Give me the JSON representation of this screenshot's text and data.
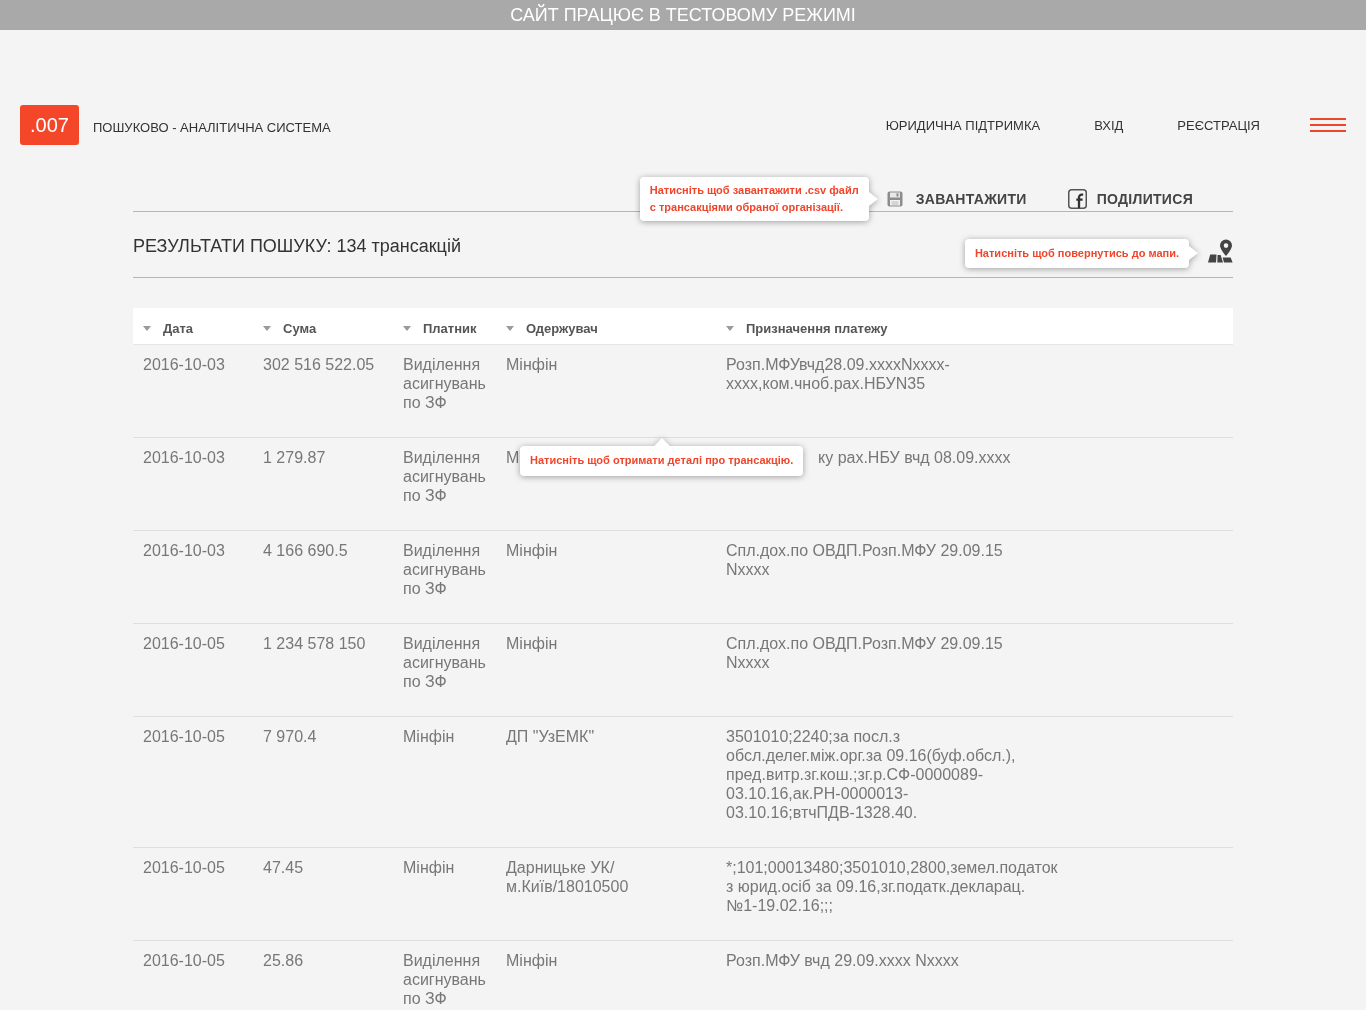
{
  "banner": {
    "text": "САЙТ ПРАЦЮЄ В ТЕСТОВОМУ РЕЖИМІ"
  },
  "header": {
    "logo": ".007",
    "subtitle": "ПОШУКОВО - АНАЛІТИЧНА СИСТЕМА",
    "nav": [
      "ЮРИДИЧНА ПІДТРИМКА",
      "ВХІД",
      "РЕЄСТРАЦІЯ"
    ]
  },
  "toolbar": {
    "tooltip": "Натисніть щоб завантажити .csv файл\nс трансакціями обраної організації.",
    "actions": [
      {
        "kind": "download",
        "label": "ЗАВАНТАЖИТИ"
      },
      {
        "kind": "share",
        "label": "ПОДІЛИТИСЯ"
      }
    ]
  },
  "results": {
    "title": "РЕЗУЛЬТАТИ ПОШУКУ: 134 трансакцій",
    "map_tooltip": "Натисніть щоб повернутись до мапи."
  },
  "table": {
    "columns": [
      "Дата",
      "Сума",
      "Платник",
      "Одержувач",
      "Призначення платежу"
    ],
    "rows": [
      {
        "date": "2016-10-03",
        "amount": "302 516 522.05",
        "payer": "Виділення\nасигнувань\nпо ЗФ",
        "recipient": "Мінфін",
        "purpose": "Розп.МФУвчд28.09.xxxxNxxxx-\nxxxx,ком.чноб.рах.НБУN35"
      },
      {
        "date": "2016-10-03",
        "amount": "1 279.87",
        "payer": "Виділення\nасигнувань\nпо ЗФ",
        "recipient": "М",
        "purpose": "ку рах.НБУ вчд 08.09.xxxx",
        "tooltip": "Натисніть щоб отримати деталі про трансакцію."
      },
      {
        "date": "2016-10-03",
        "amount": "4 166 690.5",
        "payer": "Виділення\nасигнувань\nпо ЗФ",
        "recipient": "Мінфін",
        "purpose": "Спл.дох.по ОВДП.Розп.МФУ 29.09.15\nNxxxx"
      },
      {
        "date": "2016-10-05",
        "amount": "1 234 578 150",
        "payer": "Виділення\nасигнувань\nпо ЗФ",
        "recipient": "Мінфін",
        "purpose": "Спл.дох.по ОВДП.Розп.МФУ 29.09.15\nNxxxx"
      },
      {
        "date": "2016-10-05",
        "amount": "7 970.4",
        "payer": "Мінфін",
        "recipient": "ДП \"УзЕМК\"",
        "purpose": "3501010;2240;за посл.з\nобсл.делег.між.орг.за 09.16(буф.обсл.),\nпред.витр.зг.кош.;зг.р.СФ-0000089-\n03.10.16,ак.РН-0000013-\n03.10.16;втчПДВ-1328.40."
      },
      {
        "date": "2016-10-05",
        "amount": "47.45",
        "payer": "Мінфін",
        "recipient": "Дарницьке УК/\nм.Київ/18010500",
        "purpose": "*;101;00013480;3501010,2800,земел.податок\nз юрид.осіб за 09.16,зг.податк.декларац.\n№1-19.02.16;;;"
      },
      {
        "date": "2016-10-05",
        "amount": "25.86",
        "payer": "Виділення\nасигнувань\nпо ЗФ",
        "recipient": "Мінфін",
        "purpose": "Розп.МФУ вчд 29.09.xxxx Nxxxx"
      }
    ]
  }
}
